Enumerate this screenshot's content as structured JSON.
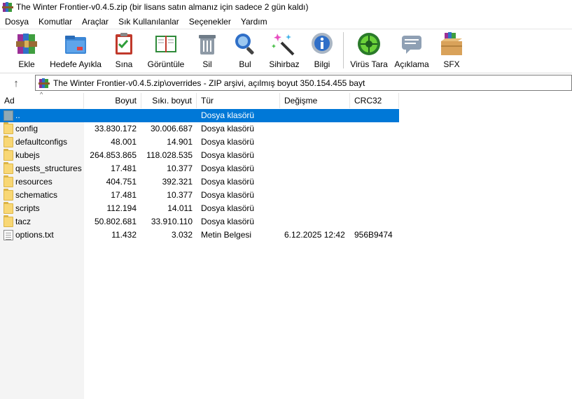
{
  "window": {
    "title": "The Winter Frontier-v0.4.5.zip (bir lisans satın almanız için sadece 2 gün kaldı)"
  },
  "menu": [
    "Dosya",
    "Komutlar",
    "Araçlar",
    "Sık Kullanılanlar",
    "Seçenekler",
    "Yardım"
  ],
  "toolbar": [
    {
      "label": "Ekle",
      "icon": "add-archive-icon"
    },
    {
      "label": "Hedefe Ayıkla",
      "icon": "extract-to-icon"
    },
    {
      "label": "Sına",
      "icon": "test-icon"
    },
    {
      "label": "Görüntüle",
      "icon": "view-book-icon"
    },
    {
      "label": "Sil",
      "icon": "trash-icon"
    },
    {
      "label": "Bul",
      "icon": "magnifier-icon"
    },
    {
      "label": "Sihirbaz",
      "icon": "wizard-wand-icon"
    },
    {
      "label": "Bilgi",
      "icon": "info-icon"
    },
    {
      "label": "Virüs Tara",
      "icon": "virus-scan-icon"
    },
    {
      "label": "Açıklama",
      "icon": "comment-icon"
    },
    {
      "label": "SFX",
      "icon": "sfx-box-icon"
    }
  ],
  "address": {
    "path": "The Winter Frontier-v0.4.5.zip\\overrides - ZIP arşivi, açılmış boyut 350.154.455 bayt"
  },
  "columns": {
    "name": "Ad",
    "size": "Boyut",
    "packed": "Sıkı. boyut",
    "type": "Tür",
    "modified": "Değişme",
    "crc": "CRC32"
  },
  "files": [
    {
      "name": "..",
      "size": "",
      "packed": "",
      "type": "Dosya klasörü",
      "modified": "",
      "crc": "",
      "kind": "parent",
      "selected": true
    },
    {
      "name": "config",
      "size": "33.830.172",
      "packed": "30.006.687",
      "type": "Dosya klasörü",
      "modified": "",
      "crc": "",
      "kind": "folder"
    },
    {
      "name": "defaultconfigs",
      "size": "48.001",
      "packed": "14.901",
      "type": "Dosya klasörü",
      "modified": "",
      "crc": "",
      "kind": "folder"
    },
    {
      "name": "kubejs",
      "size": "264.853.865",
      "packed": "118.028.535",
      "type": "Dosya klasörü",
      "modified": "",
      "crc": "",
      "kind": "folder"
    },
    {
      "name": "quests_structures",
      "size": "17.481",
      "packed": "10.377",
      "type": "Dosya klasörü",
      "modified": "",
      "crc": "",
      "kind": "folder"
    },
    {
      "name": "resources",
      "size": "404.751",
      "packed": "392.321",
      "type": "Dosya klasörü",
      "modified": "",
      "crc": "",
      "kind": "folder"
    },
    {
      "name": "schematics",
      "size": "17.481",
      "packed": "10.377",
      "type": "Dosya klasörü",
      "modified": "",
      "crc": "",
      "kind": "folder"
    },
    {
      "name": "scripts",
      "size": "112.194",
      "packed": "14.011",
      "type": "Dosya klasörü",
      "modified": "",
      "crc": "",
      "kind": "folder"
    },
    {
      "name": "tacz",
      "size": "50.802.681",
      "packed": "33.910.110",
      "type": "Dosya klasörü",
      "modified": "",
      "crc": "",
      "kind": "folder"
    },
    {
      "name": "options.txt",
      "size": "11.432",
      "packed": "3.032",
      "type": "Metin Belgesi",
      "modified": "6.12.2025 12:42",
      "crc": "956B9474",
      "kind": "text"
    }
  ],
  "colors": {
    "selection": "#0078d7",
    "folder": "#f8d775"
  }
}
